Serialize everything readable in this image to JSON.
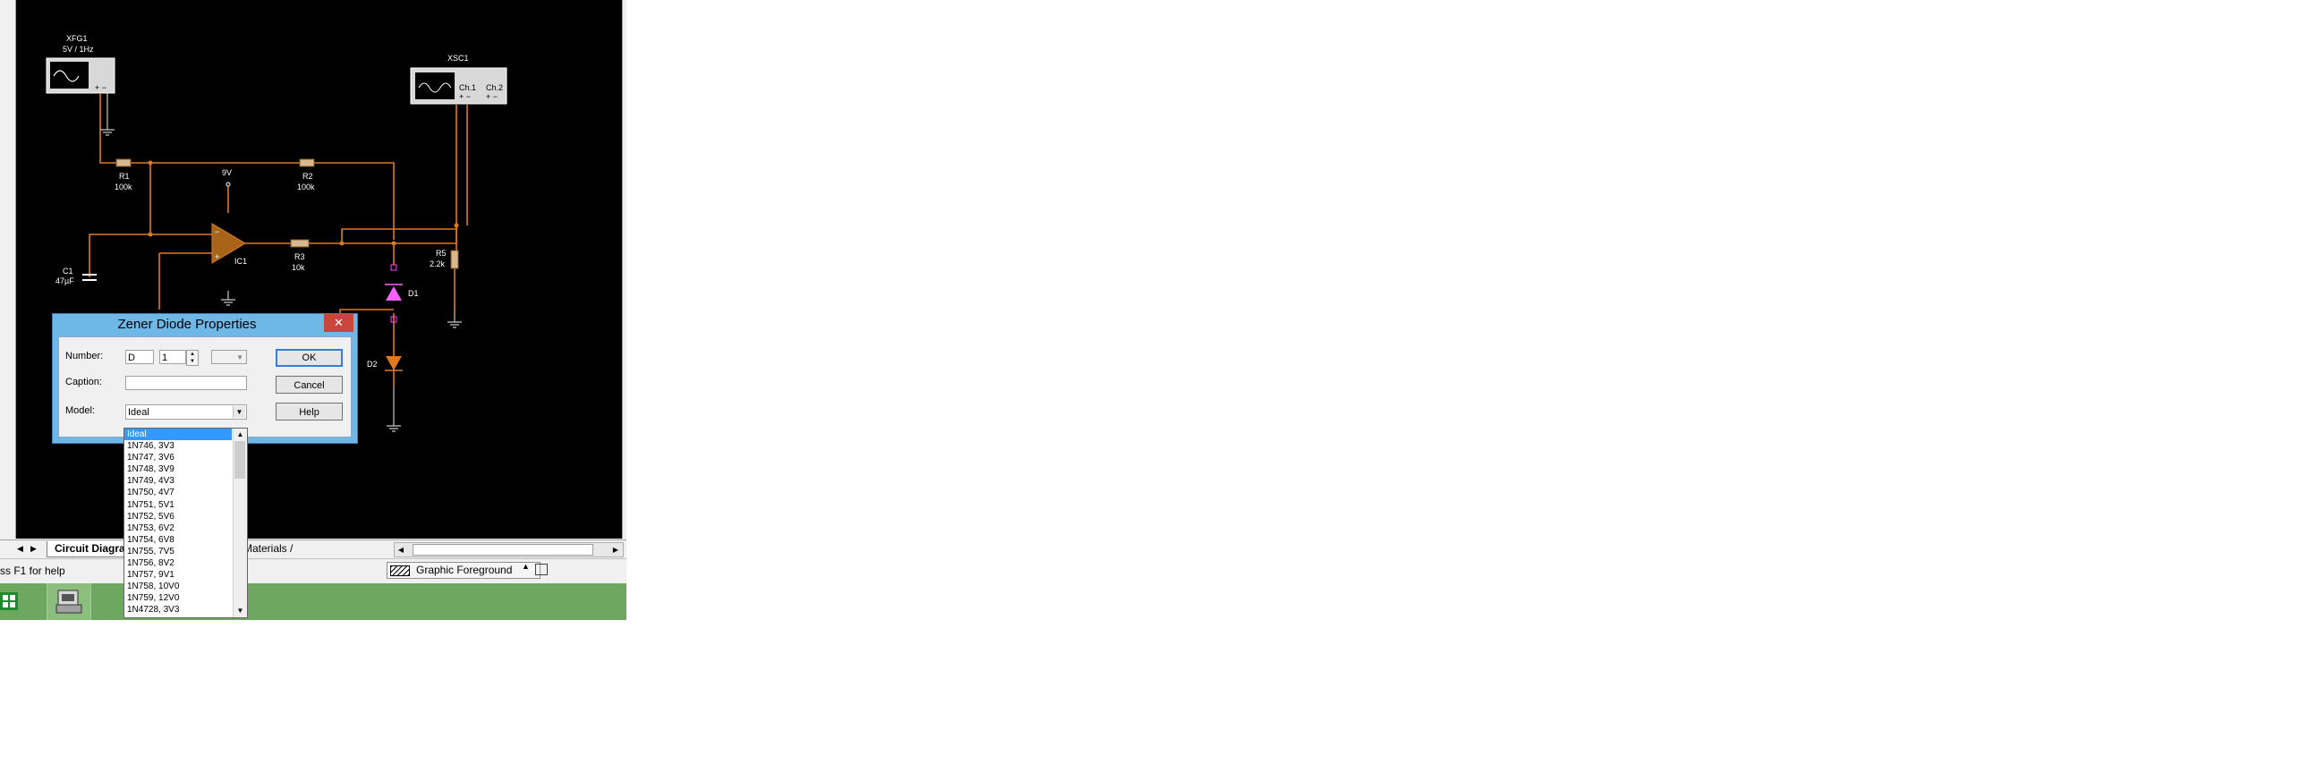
{
  "circuit": {
    "xfg1_name": "XFG1",
    "xfg1_value": "5V / 1Hz",
    "xsc1_name": "XSC1",
    "xsc1_ch1": "Ch.1",
    "xsc1_ch2": "Ch.2",
    "r1_name": "R1",
    "r1_value": "100k",
    "r2_name": "R2",
    "r2_value": "100k",
    "r3_name": "R3",
    "r3_value": "10k",
    "r5_name": "R5",
    "r5_value": "2.2k",
    "c1_name": "C1",
    "c1_value": "47µF",
    "supply_label": "9V",
    "ic1_name": "IC1",
    "d1_name": "D1",
    "d2_name": "D2"
  },
  "tabs": {
    "circuit_label": "Circuit Diagra",
    "materials_label": "Materials /"
  },
  "status": {
    "help_text": "ss F1 for help",
    "layer_name": "Graphic Foreground"
  },
  "dialog": {
    "title": "Zener Diode Properties",
    "close_glyph": "✕",
    "number_label": "Number:",
    "number_prefix": "D",
    "number_index": "1",
    "caption_label": "Caption:",
    "caption_value": "",
    "model_label": "Model:",
    "model_value": "Ideal",
    "ok_label": "OK",
    "cancel_label": "Cancel",
    "help_label": "Help"
  },
  "model_options": [
    "Ideal",
    "1N746, 3V3",
    "1N747, 3V6",
    "1N748, 3V9",
    "1N749, 4V3",
    "1N750, 4V7",
    "1N751, 5V1",
    "1N752, 5V6",
    "1N753, 6V2",
    "1N754, 6V8",
    "1N755, 7V5",
    "1N756, 8V2",
    "1N757, 9V1",
    "1N758, 10V0",
    "1N759, 12V0",
    "1N4728, 3V3"
  ],
  "colors": {
    "wire": "#e07820",
    "canvas": "#000000",
    "dialog_frame": "#6fb7e6",
    "close_button": "#c9463d",
    "selection": "#3399ff",
    "taskbar": "#6ea860"
  }
}
